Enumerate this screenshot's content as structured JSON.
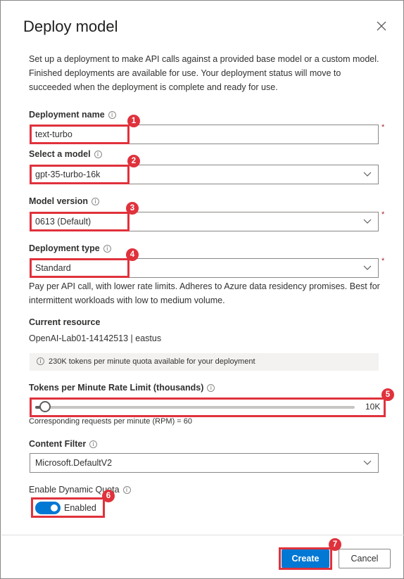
{
  "dialog": {
    "title": "Deploy model",
    "description": "Set up a deployment to make API calls against a provided base model or a custom model. Finished deployments are available for use. Your deployment status will move to succeeded when the deployment is complete and ready for use."
  },
  "fields": {
    "deployment_name": {
      "label": "Deployment name",
      "value": "text-turbo"
    },
    "model": {
      "label": "Select a model",
      "value": "gpt-35-turbo-16k"
    },
    "model_version": {
      "label": "Model version",
      "value": "0613 (Default)"
    },
    "deployment_type": {
      "label": "Deployment type",
      "value": "Standard",
      "help": "Pay per API call, with lower rate limits. Adheres to Azure data residency promises. Best for intermittent workloads with low to medium volume."
    },
    "content_filter": {
      "label": "Content Filter",
      "value": "Microsoft.DefaultV2"
    }
  },
  "required_marker": "*",
  "info_glyph": "i",
  "resource": {
    "label": "Current resource",
    "value": "OpenAI-Lab01-14142513 | eastus",
    "quota_note": "230K tokens per minute quota available for your deployment"
  },
  "rate_limit": {
    "label": "Tokens per Minute Rate Limit (thousands)",
    "value_label": "10K",
    "value": 10,
    "fill_fraction": 0.03,
    "rpm_note": "Corresponding requests per minute (RPM) = 60"
  },
  "dynamic_quota": {
    "label": "Enable Dynamic Quota",
    "state_label": "Enabled",
    "on": true
  },
  "buttons": {
    "create": "Create",
    "cancel": "Cancel"
  },
  "badges": [
    "1",
    "2",
    "3",
    "4",
    "5",
    "6",
    "7"
  ],
  "colors": {
    "accent": "#0078d4",
    "highlight": "#e0323c",
    "required": "#a4262c"
  }
}
